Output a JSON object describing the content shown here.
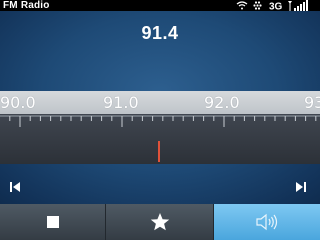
{
  "status": {
    "app_title": "FM Radio",
    "network": "3G",
    "icons": [
      "wifi-icon",
      "blackberry-icon",
      "3g-icon",
      "signal-icon"
    ]
  },
  "tuner": {
    "current_frequency": "91.4",
    "scale_labels": [
      "90.0",
      "91.0",
      "92.0",
      "93"
    ]
  },
  "bottom_bar": {
    "buttons": [
      "stop-icon",
      "favorite-star-icon",
      "speaker-icon"
    ],
    "active": "speaker-icon"
  },
  "colors": {
    "accent": "#4aa6dd",
    "needle": "#e0523a",
    "background": "#1e4a76"
  }
}
